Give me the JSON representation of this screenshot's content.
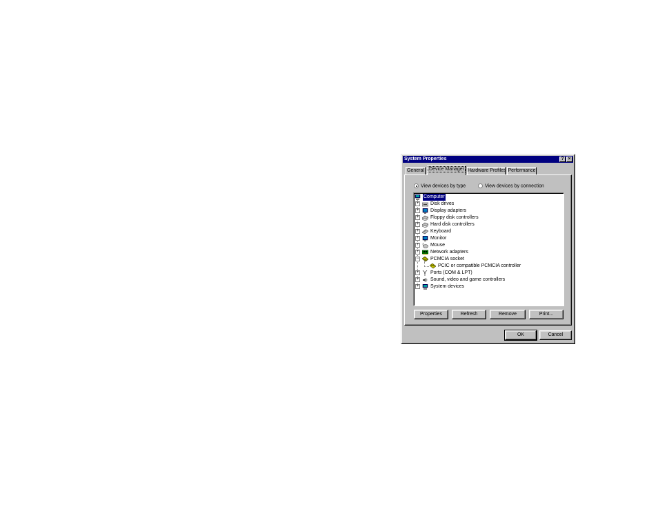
{
  "window": {
    "title": "System Properties",
    "help_glyph": "?",
    "close_glyph": "×"
  },
  "tabs": [
    {
      "label": "General",
      "active": false
    },
    {
      "label": "Device Manager",
      "active": true
    },
    {
      "label": "Hardware Profiles",
      "active": false
    },
    {
      "label": "Performance",
      "active": false
    }
  ],
  "view_options": {
    "by_type": {
      "label": "View devices by type",
      "checked": true
    },
    "by_connection": {
      "label": "View devices by connection",
      "checked": false
    }
  },
  "device_tree": [
    {
      "label": "Computer",
      "icon": "computer-icon",
      "expander": "",
      "selected": true
    },
    {
      "label": "Disk drives",
      "icon": "disk-drive-icon",
      "expander": "+"
    },
    {
      "label": "Display adapters",
      "icon": "display-adapter-icon",
      "expander": "+"
    },
    {
      "label": "Floppy disk controllers",
      "icon": "floppy-controller-icon",
      "expander": "+"
    },
    {
      "label": "Hard disk controllers",
      "icon": "hard-disk-controller-icon",
      "expander": "+"
    },
    {
      "label": "Keyboard",
      "icon": "keyboard-icon",
      "expander": "+"
    },
    {
      "label": "Monitor",
      "icon": "monitor-icon",
      "expander": "+"
    },
    {
      "label": "Mouse",
      "icon": "mouse-icon",
      "expander": "+"
    },
    {
      "label": "Network adapters",
      "icon": "network-adapter-icon",
      "expander": "+"
    },
    {
      "label": "PCMCIA socket",
      "icon": "pcmcia-socket-icon",
      "expander": "−"
    },
    {
      "label": "PCIC or compatible PCMCIA controller",
      "icon": "pcmcia-controller-icon",
      "expander": "",
      "child": true
    },
    {
      "label": "Ports (COM & LPT)",
      "icon": "ports-icon",
      "expander": "+"
    },
    {
      "label": "Sound, video and game controllers",
      "icon": "sound-icon",
      "expander": "+"
    },
    {
      "label": "System devices",
      "icon": "system-devices-icon",
      "expander": "+"
    }
  ],
  "panel_buttons": {
    "properties": "Properties",
    "refresh": "Refresh",
    "remove": "Remove",
    "print": "Print..."
  },
  "dialog_buttons": {
    "ok": "OK",
    "cancel": "Cancel"
  },
  "colors": {
    "titlebar": "#000080",
    "face": "#c0c0c0",
    "selection": "#000080"
  }
}
